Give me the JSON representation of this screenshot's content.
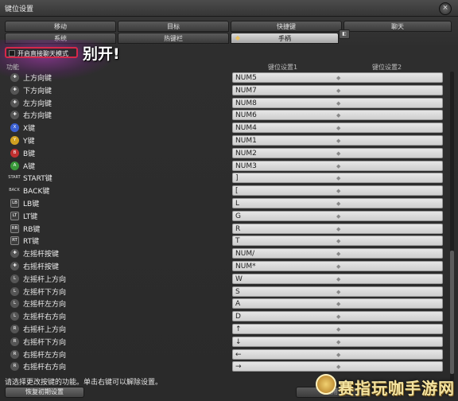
{
  "window": {
    "title": "键位设置",
    "close_label": "×"
  },
  "tabs_row1": [
    {
      "label": "移动"
    },
    {
      "label": "目标"
    },
    {
      "label": "快捷键"
    },
    {
      "label": "聊天"
    }
  ],
  "tabs_row2": [
    {
      "label": "系统"
    },
    {
      "label": "热键栏"
    },
    {
      "label": "手柄",
      "active": true
    }
  ],
  "side_toggle": "◧",
  "chat_mode": {
    "label": "开启直接聊天模式",
    "checked": false
  },
  "annotation": "别开!",
  "columns": {
    "function": "功能",
    "binding1": "键位设置1",
    "binding2": "键位设置2"
  },
  "rows": [
    {
      "icon": "dpad-up-icon",
      "glyph": "✚",
      "name": "上方向键",
      "key1": "NUM5",
      "key2": "◆"
    },
    {
      "icon": "dpad-down-icon",
      "glyph": "✚",
      "name": "下方向键",
      "key1": "NUM7",
      "key2": "◆"
    },
    {
      "icon": "dpad-left-icon",
      "glyph": "✚",
      "name": "左方向键",
      "key1": "NUM8",
      "key2": "◆"
    },
    {
      "icon": "dpad-right-icon",
      "glyph": "✚",
      "name": "右方向键",
      "key1": "NUM6",
      "key2": "◆"
    },
    {
      "icon": "x-button-icon",
      "glyph": "X",
      "name": "X键",
      "key1": "NUM4",
      "key2": "◆",
      "color": "#3a5fd0"
    },
    {
      "icon": "y-button-icon",
      "glyph": "Y",
      "name": "Y键",
      "key1": "NUM1",
      "key2": "◆",
      "color": "#d0a020"
    },
    {
      "icon": "b-button-icon",
      "glyph": "B",
      "name": "B键",
      "key1": "NUM2",
      "key2": "◆",
      "color": "#c03030"
    },
    {
      "icon": "a-button-icon",
      "glyph": "A",
      "name": "A键",
      "key1": "NUM3",
      "key2": "◆",
      "color": "#3a9a3a"
    },
    {
      "icon": "start-button-icon",
      "glyph": "START",
      "name": "START键",
      "key1": "]",
      "key2": "◆",
      "wide": true
    },
    {
      "icon": "back-button-icon",
      "glyph": "BACK",
      "name": "BACK键",
      "key1": "[",
      "key2": "◆",
      "wide": true
    },
    {
      "icon": "lb-button-icon",
      "glyph": "LB",
      "name": "LB键",
      "key1": "L",
      "key2": "◆",
      "square": true
    },
    {
      "icon": "lt-button-icon",
      "glyph": "LT",
      "name": "LT键",
      "key1": "G",
      "key2": "◆",
      "square": true
    },
    {
      "icon": "rb-button-icon",
      "glyph": "RB",
      "name": "RB键",
      "key1": "R",
      "key2": "◆",
      "square": true
    },
    {
      "icon": "rt-button-icon",
      "glyph": "RT",
      "name": "RT键",
      "key1": "T",
      "key2": "◆",
      "square": true
    },
    {
      "icon": "left-stick-press-icon",
      "glyph": "✚",
      "name": "左摇杆按键",
      "key1": "NUM/",
      "key2": "◆"
    },
    {
      "icon": "right-stick-press-icon",
      "glyph": "✚",
      "name": "右摇杆按键",
      "key1": "NUM*",
      "key2": "◆"
    },
    {
      "icon": "left-stick-up-icon",
      "glyph": "L",
      "name": "左摇杆上方向",
      "key1": "W",
      "key2": "◆"
    },
    {
      "icon": "left-stick-down-icon",
      "glyph": "L",
      "name": "左摇杆下方向",
      "key1": "S",
      "key2": "◆"
    },
    {
      "icon": "left-stick-left-icon",
      "glyph": "L",
      "name": "左摇杆左方向",
      "key1": "A",
      "key2": "◆"
    },
    {
      "icon": "left-stick-right-icon",
      "glyph": "L",
      "name": "左摇杆右方向",
      "key1": "D",
      "key2": "◆"
    },
    {
      "icon": "right-stick-up-icon",
      "glyph": "R",
      "name": "右摇杆上方向",
      "key1": "↑",
      "key2": "◆"
    },
    {
      "icon": "right-stick-down-icon",
      "glyph": "R",
      "name": "右摇杆下方向",
      "key1": "↓",
      "key2": "◆"
    },
    {
      "icon": "right-stick-left-icon",
      "glyph": "R",
      "name": "右摇杆左方向",
      "key1": "←",
      "key2": "◆"
    },
    {
      "icon": "right-stick-right-icon",
      "glyph": "R",
      "name": "右摇杆右方向",
      "key1": "→",
      "key2": "◆"
    }
  ],
  "hint": "请选择更改按键的功能。单击右键可以解除设置。",
  "buttons": {
    "reset": "恢复初期设置",
    "apply": "应用"
  },
  "watermark": "赛指玩咖手游网"
}
